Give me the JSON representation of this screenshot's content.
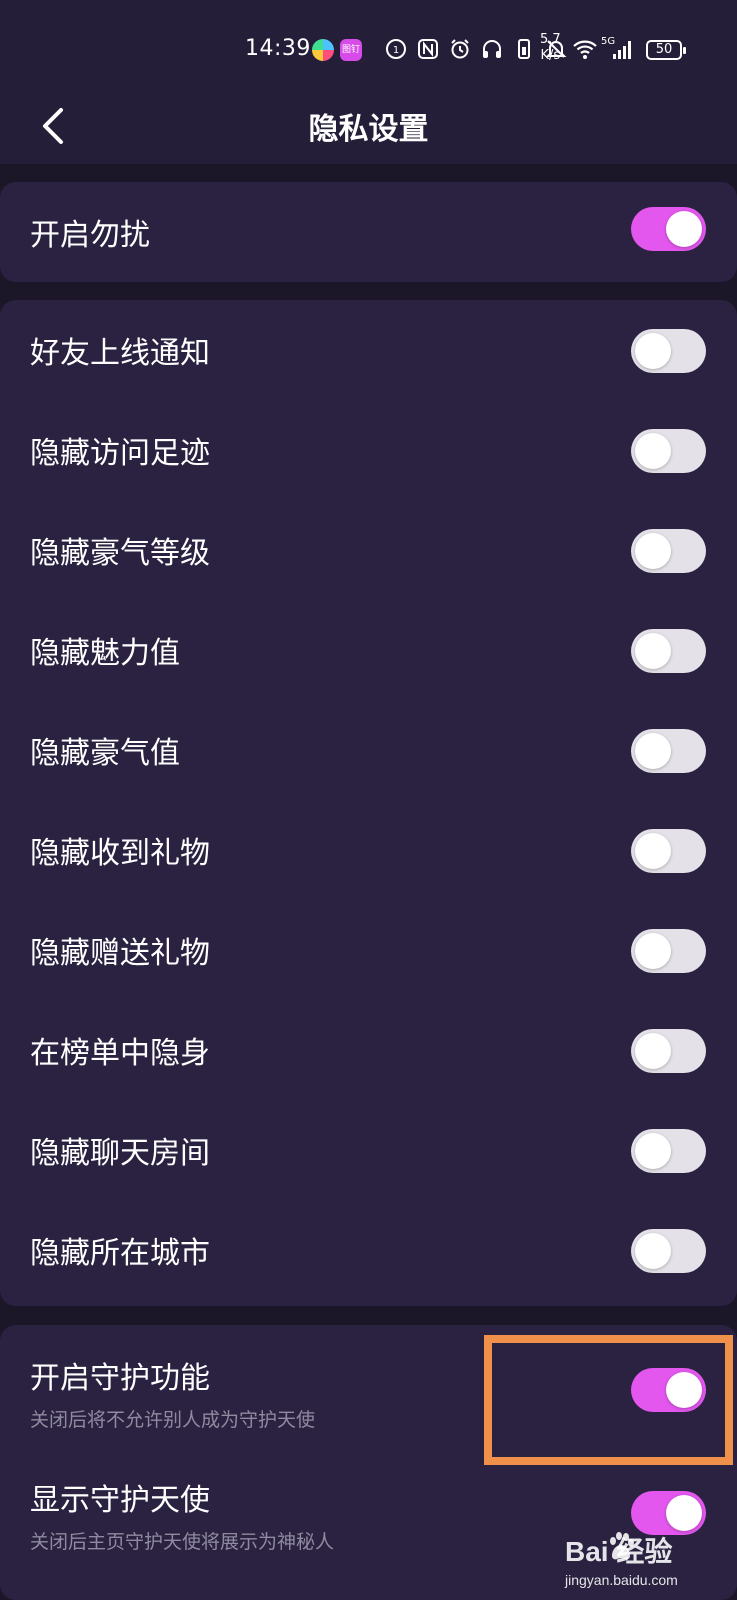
{
  "status_bar": {
    "time": "14:39",
    "app_badge": "图钉",
    "net_speed_value": "5.7",
    "net_speed_unit": "K/s",
    "signal_label": "5G",
    "battery": "50",
    "icons": [
      "nfc-data-icon",
      "nfc-icon",
      "alarm-icon",
      "headphones-icon",
      "vibrate-icon",
      "mute-bell-icon",
      "wifi-icon",
      "signal-bars-icon",
      "battery-icon"
    ]
  },
  "header": {
    "title": "隐私设置",
    "back_icon": "chevron-left-icon"
  },
  "settings": {
    "do_not_disturb": {
      "label": "开启勿扰",
      "on": true
    },
    "list": [
      {
        "label": "好友上线通知",
        "on": false
      },
      {
        "label": "隐藏访问足迹",
        "on": false
      },
      {
        "label": "隐藏豪气等级",
        "on": false
      },
      {
        "label": "隐藏魅力值",
        "on": false
      },
      {
        "label": "隐藏豪气值",
        "on": false
      },
      {
        "label": "隐藏收到礼物",
        "on": false
      },
      {
        "label": "隐藏赠送礼物",
        "on": false
      },
      {
        "label": "在榜单中隐身",
        "on": false
      },
      {
        "label": "隐藏聊天房间",
        "on": false
      },
      {
        "label": "隐藏所在城市",
        "on": false
      }
    ],
    "guard": {
      "label": "开启守护功能",
      "sublabel": "关闭后将不允许别人成为守护天使",
      "on": true
    },
    "show_guard": {
      "label": "显示守护天使",
      "sublabel": "关闭后主页守护天使将展示为神秘人",
      "on": true
    }
  },
  "colors": {
    "background": "#1c1728",
    "card": "#2a2240",
    "toggle_on": "#e357ee",
    "toggle_off": "#e4e2e8",
    "highlight": "#f0914b"
  },
  "watermark": {
    "brand": "Bai  经验",
    "url": "jingyan.baidu.com"
  }
}
